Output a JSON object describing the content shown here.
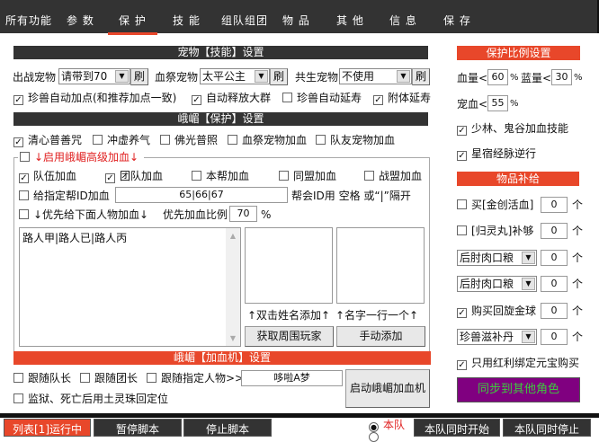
{
  "tabs": [
    "所有功能",
    "参 数",
    "保 护",
    "技 能",
    "组队组团",
    "物 品",
    "其 他",
    "信 息",
    "保 存"
  ],
  "pet": {
    "header": "宠物【技能】设置",
    "out_label": "出战宠物",
    "out_value": "请带到70",
    "refresh": "刷",
    "blood_label": "血祭宠物",
    "blood_value": "太平公主",
    "sym_label": "共生宠物",
    "sym_value": "不使用",
    "checks": [
      {
        "label": "珍兽自动加点(和推荐加点一致)",
        "checked": true
      },
      {
        "label": "自动释放大群",
        "checked": true
      },
      {
        "label": "珍兽自动延寿",
        "checked": false
      },
      {
        "label": "附体延寿",
        "checked": true
      }
    ]
  },
  "emei": {
    "header": "峨嵋【保护】设置",
    "checks": [
      {
        "label": "清心普善咒",
        "checked": true
      },
      {
        "label": "冲虚养气",
        "checked": false
      },
      {
        "label": "佛光普照",
        "checked": false
      },
      {
        "label": "血祭宠物加血",
        "checked": false
      },
      {
        "label": "队友宠物加血",
        "checked": false
      }
    ],
    "advanced_label": "↓启用峨嵋高级加血↓",
    "advanced_checked": false,
    "heal_checks": [
      {
        "label": "队伍加血",
        "checked": true
      },
      {
        "label": "团队加血",
        "checked": true
      },
      {
        "label": "本帮加血",
        "checked": false
      },
      {
        "label": "同盟加血",
        "checked": false
      },
      {
        "label": "战盟加血",
        "checked": false
      }
    ],
    "guild_label": "给指定帮ID加血",
    "guild_value": "65|66|67",
    "guild_hint": "帮会ID用 空格 或“|”隔开",
    "priority_label": "↓优先给下面人物加血↓",
    "priority_ratio_label": "优先加血比例",
    "priority_ratio": "70",
    "pct": "%",
    "names_text": "路人甲|路人已|路人丙",
    "hint1": "↑双击姓名添加↑",
    "hint2": "↑名字一行一个↑",
    "get_btn": "获取周围玩家",
    "add_btn": "手动添加"
  },
  "healer": {
    "header": "峨嵋【加血机】设置",
    "follow_leader": "跟随队长",
    "follow_group": "跟随团长",
    "follow_person": "跟随指定人物>>",
    "person_value": "哆啦A梦",
    "jail": "监狱、死亡后用土灵珠回定位",
    "start_btn": "启动峨嵋加血机"
  },
  "ratio": {
    "header": "保护比例设置",
    "hp_label": "血量<",
    "hp": "60",
    "mp_label": "蓝量<",
    "mp": "30",
    "pet_label": "宠血<",
    "pet": "55",
    "pct": "%",
    "checks": [
      {
        "label": "少林、鬼谷加血技能",
        "checked": true
      },
      {
        "label": "星宿经脉逆行",
        "checked": true
      }
    ]
  },
  "supply": {
    "header": "物品补给",
    "unit": "个",
    "buy_herb": "买[金创活血]",
    "buy_herb_qty": "0",
    "gui": "[归灵丸]补够",
    "gui_qty": "0",
    "food1": "后肘肉口粮",
    "food1_qty": "0",
    "food2": "后肘肉口粮",
    "food2_qty": "0",
    "ball": "购买回旋金球",
    "ball_qty": "0",
    "pill": "珍兽滋补丹",
    "pill_qty": "0",
    "bonus_only": "只用红利绑定元宝购买",
    "sync_btn": "同步到其他角色"
  },
  "bottom": {
    "running": "列表[1]运行中",
    "pause": "暂停脚本",
    "stop": "停止脚本",
    "radio1": "本队",
    "team_start": "本队同时开始",
    "team_stop": "本队同时停止"
  },
  "colors": {
    "accent": "#e8472a",
    "dark": "#333333",
    "purple": "#800080",
    "sync_text": "#3ec83e"
  }
}
